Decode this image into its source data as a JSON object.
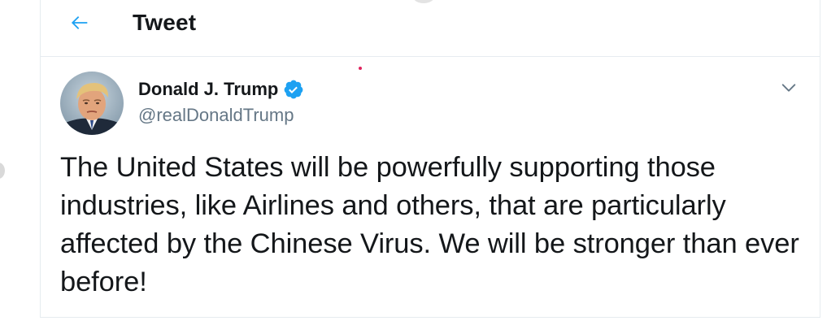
{
  "header": {
    "back_icon": "arrow-left-icon",
    "title": "Tweet"
  },
  "tweet": {
    "author": {
      "display_name": "Donald J. Trump",
      "handle": "@realDonaldTrump",
      "verified_icon": "verified-badge-icon",
      "avatar_icon": "avatar-photo"
    },
    "menu_icon": "chevron-down-icon",
    "text": "The United States will be powerfully supporting those industries, like Airlines and others, that are particularly affected by the Chinese Virus. We will be stronger than ever before!"
  },
  "colors": {
    "accent": "#1da1f2",
    "text_primary": "#14171a",
    "text_secondary": "#657786",
    "border": "#e6ecf0"
  }
}
